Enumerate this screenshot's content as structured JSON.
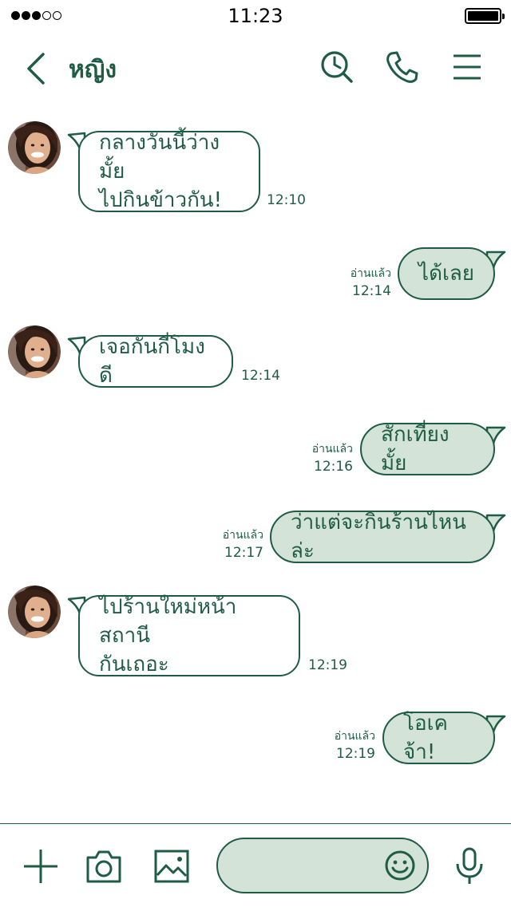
{
  "status_bar": {
    "time": "11:23",
    "signal_bars": 5,
    "signal_filled": 3
  },
  "header": {
    "contact_name": "หญิง"
  },
  "colors": {
    "accent": "#1f5c45",
    "outgoing_bubble": "#d4e3d8",
    "background": "#ffffff"
  },
  "icons": {
    "back": "chevron-left-icon",
    "history": "clock-search-icon",
    "call": "phone-icon",
    "menu": "hamburger-menu-icon",
    "add": "plus-icon",
    "camera": "camera-icon",
    "gallery": "image-icon",
    "sticker": "smiley-icon",
    "voice": "microphone-icon"
  },
  "messages": [
    {
      "direction": "in",
      "text": "กลางวันนี้ว่างมั้ย\nไปกินข้าวกัน!",
      "time": "12:10"
    },
    {
      "direction": "out",
      "text": "ได้เลย",
      "time": "12:14",
      "read_label": "อ่านแล้ว"
    },
    {
      "direction": "in",
      "text": "เจอกันกี่โมงดี",
      "time": "12:14"
    },
    {
      "direction": "out",
      "text": "สักเที่ยงมั้ย",
      "time": "12:16",
      "read_label": "อ่านแล้ว"
    },
    {
      "direction": "out",
      "text": "ว่าแต่จะกินร้านไหนล่ะ",
      "time": "12:17",
      "read_label": "อ่านแล้ว"
    },
    {
      "direction": "in",
      "text": "ไปร้านใหม่หน้าสถานี\nกันเถอะ",
      "time": "12:19"
    },
    {
      "direction": "out",
      "text": "โอเคจ้า!",
      "time": "12:19",
      "read_label": "อ่านแล้ว"
    }
  ],
  "composer": {
    "input_value": "",
    "placeholder": ""
  }
}
